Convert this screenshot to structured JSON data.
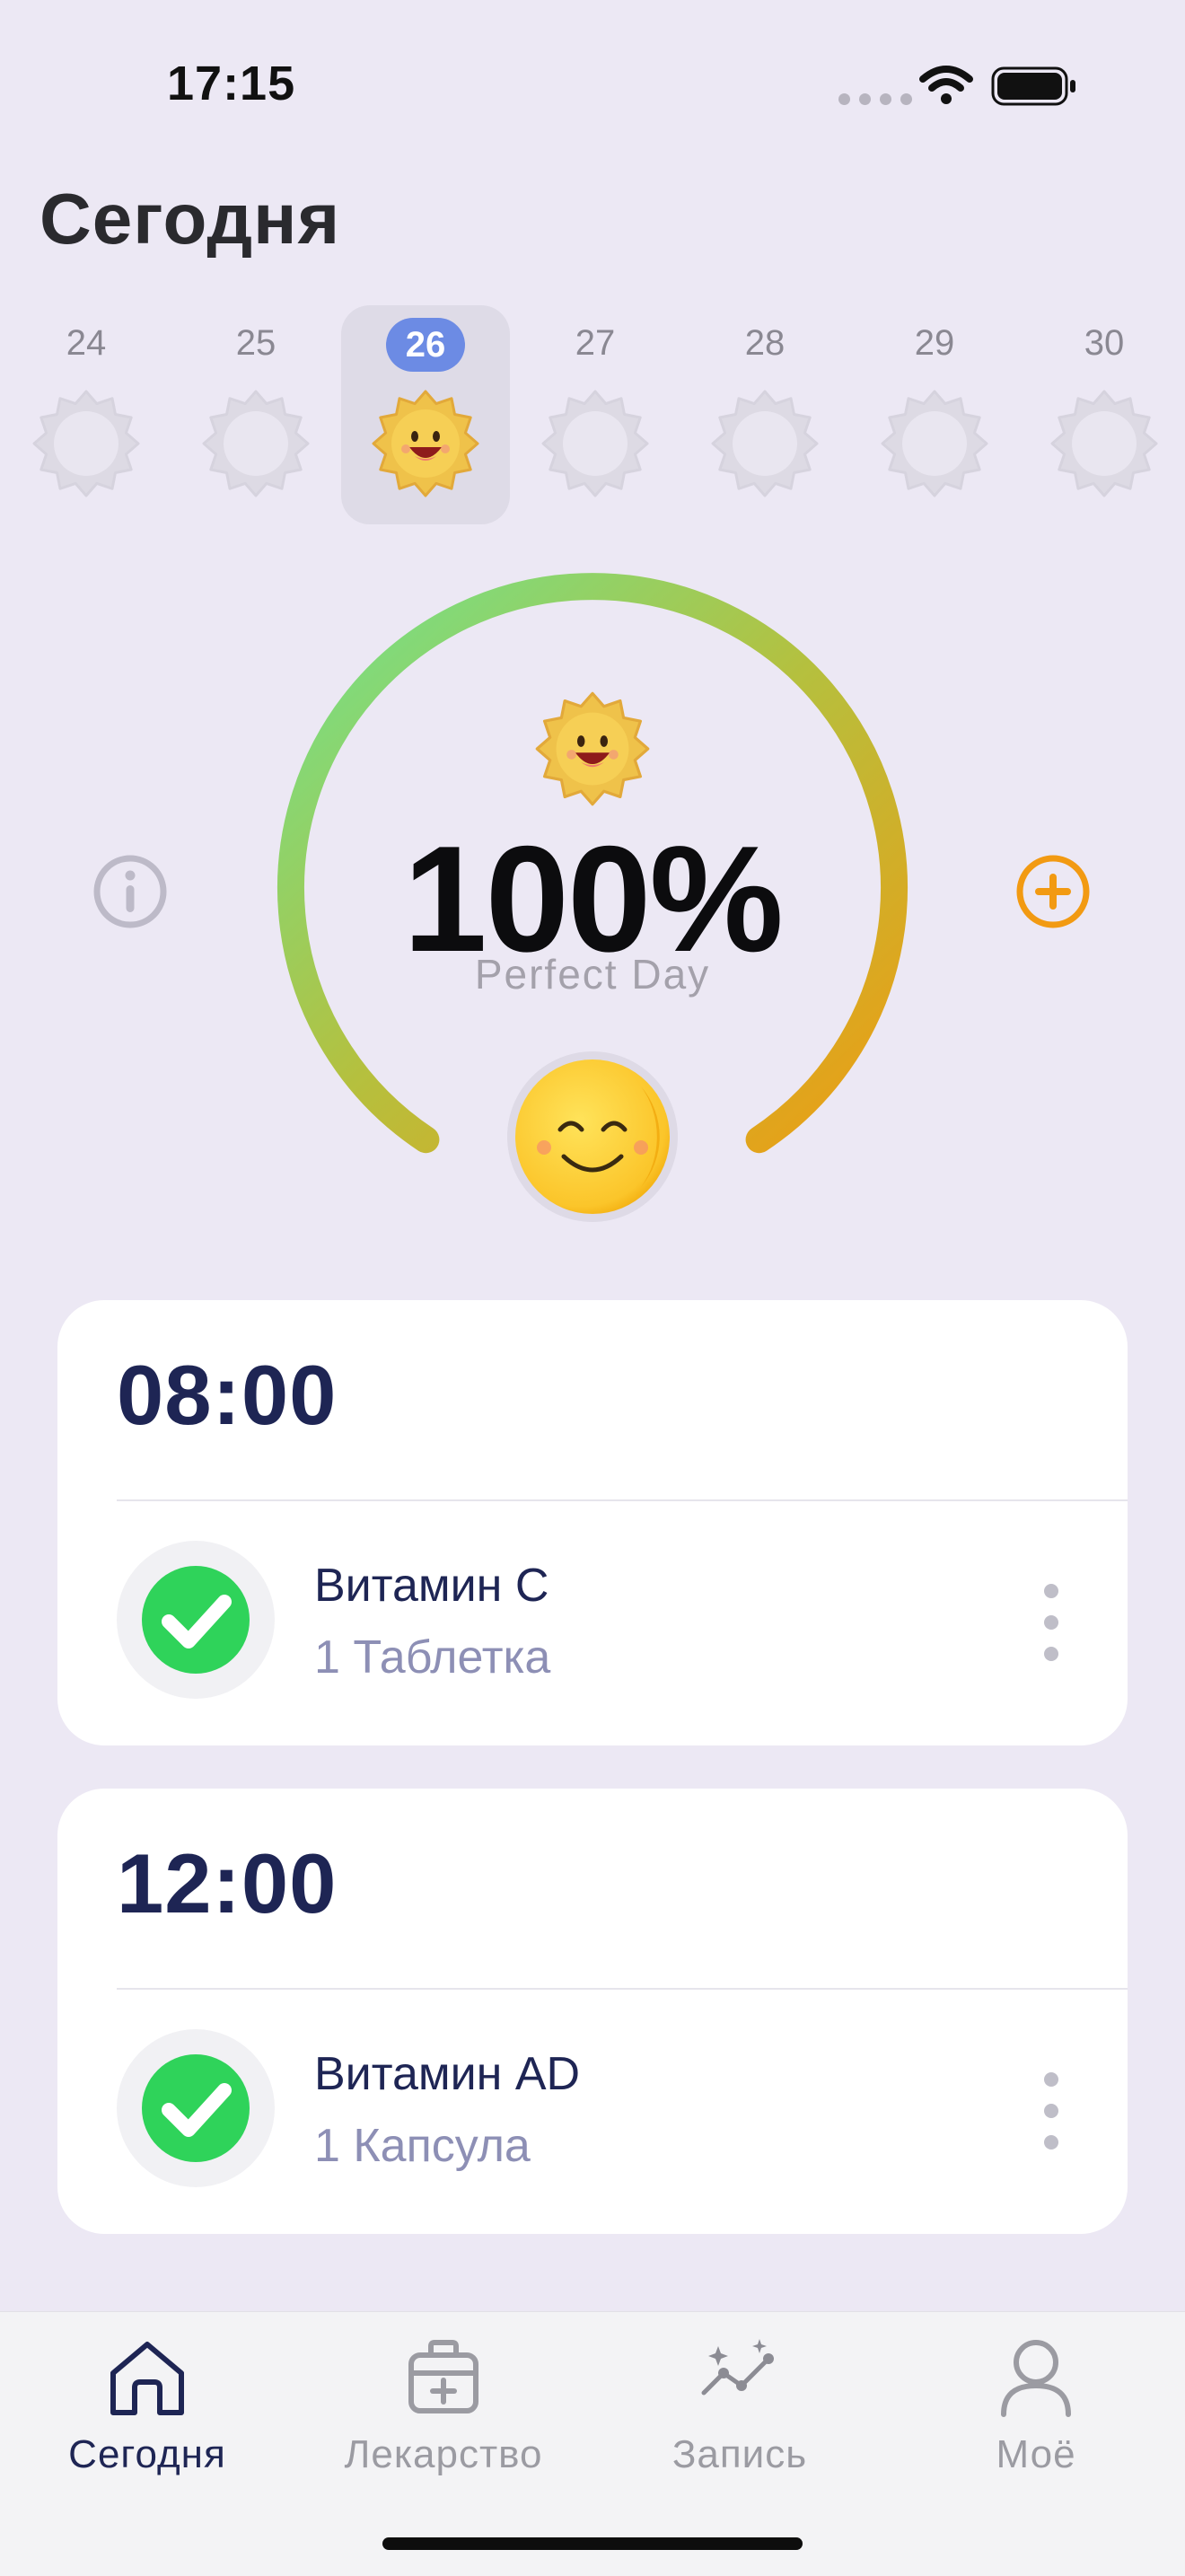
{
  "status_bar": {
    "time": "17:15"
  },
  "header": {
    "title": "Сегодня"
  },
  "days": [
    {
      "label": "24",
      "selected": false
    },
    {
      "label": "25",
      "selected": false
    },
    {
      "label": "26",
      "selected": true
    },
    {
      "label": "27",
      "selected": false
    },
    {
      "label": "28",
      "selected": false
    },
    {
      "label": "29",
      "selected": false
    },
    {
      "label": "30",
      "selected": false
    }
  ],
  "progress": {
    "percent_text": "100%",
    "value": 1.0,
    "subtitle": "Perfect Day"
  },
  "icons": {
    "info": "info-circle-icon",
    "add": "plus-circle-icon",
    "mood": "smiley-face-icon"
  },
  "colors": {
    "accent_orange": "#F29A12",
    "ring_start": "#6FE38F",
    "ring_mid": "#B5C03E",
    "ring_end": "#EE9C12",
    "check_green": "#2FD35A",
    "navy": "#1E2554",
    "selected_day": "#6C8BE4"
  },
  "schedule": [
    {
      "time": "08:00",
      "medicine": "Витамин C",
      "dose": "1 Таблетка",
      "taken": true
    },
    {
      "time": "12:00",
      "medicine": "Витамин AD",
      "dose": "1 Капсула",
      "taken": true
    }
  ],
  "tabs": [
    {
      "label": "Сегодня",
      "icon": "home-icon",
      "active": true
    },
    {
      "label": "Лекарство",
      "icon": "medicine-kit-icon",
      "active": false
    },
    {
      "label": "Запись",
      "icon": "chart-sparkle-icon",
      "active": false
    },
    {
      "label": "Моё",
      "icon": "person-icon",
      "active": false
    }
  ]
}
